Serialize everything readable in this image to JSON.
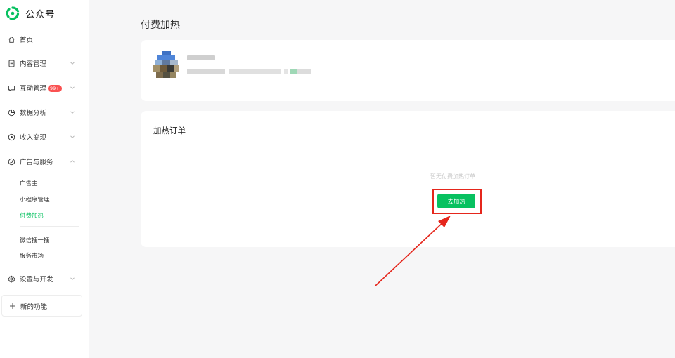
{
  "app": {
    "name": "公众号"
  },
  "sidebar": {
    "items": [
      {
        "label": "首页",
        "icon": "home-icon"
      },
      {
        "label": "内容管理",
        "icon": "document-icon"
      },
      {
        "label": "互动管理",
        "icon": "message-icon",
        "badge": "99+"
      },
      {
        "label": "数据分析",
        "icon": "pie-chart-icon"
      },
      {
        "label": "收入变现",
        "icon": "coin-icon"
      },
      {
        "label": "广告与服务",
        "icon": "compass-icon"
      }
    ],
    "ads_sub_items": [
      {
        "label": "广告主"
      },
      {
        "label": "小程序管理"
      },
      {
        "label": "付费加热",
        "active": true
      },
      {
        "label": "微信搜一搜"
      },
      {
        "label": "服务市场"
      }
    ],
    "settings": {
      "label": "设置与开发",
      "icon": "gear-icon"
    },
    "new_features": {
      "label": "新的功能",
      "icon": "plus-icon"
    }
  },
  "main": {
    "page_title": "付费加热",
    "orders_section": {
      "title": "加热订单",
      "empty_text": "暂无付费加热订单",
      "button_label": "去加热"
    }
  },
  "colors": {
    "accent": "#07c160",
    "badge": "#fa5151",
    "annotation": "#e5261c",
    "background": "#f6f6f7"
  }
}
